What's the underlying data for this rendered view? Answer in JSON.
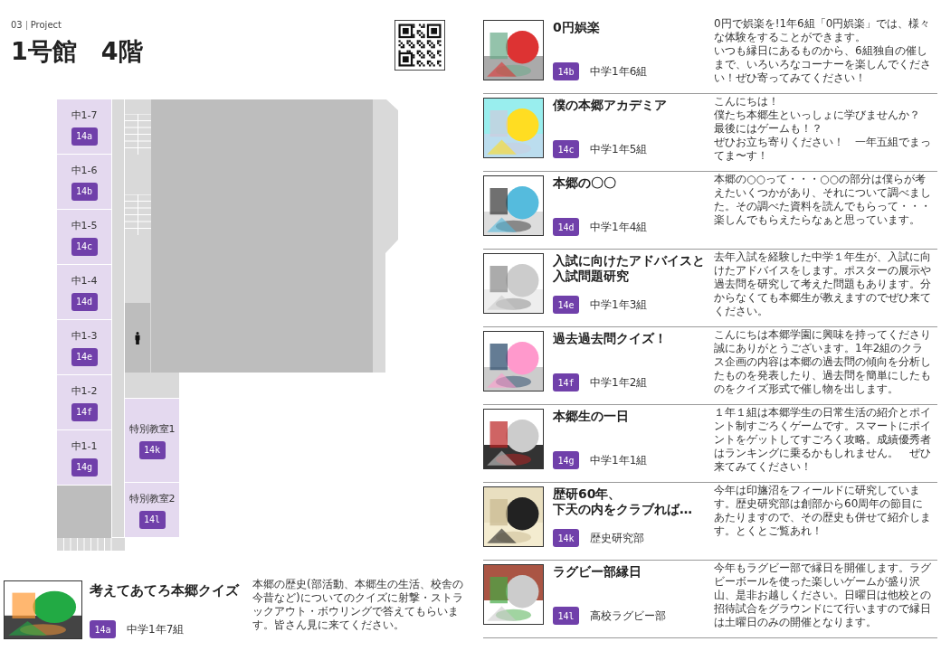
{
  "header": {
    "number": "03",
    "section": "Project",
    "title": "1号館　4階"
  },
  "floor_plan": {
    "rooms": [
      {
        "label": "中1-7",
        "code": "14a"
      },
      {
        "label": "中1-6",
        "code": "14b"
      },
      {
        "label": "中1-5",
        "code": "14c"
      },
      {
        "label": "中1-4",
        "code": "14d"
      },
      {
        "label": "中1-3",
        "code": "14e"
      },
      {
        "label": "中1-2",
        "code": "14f"
      },
      {
        "label": "中1-1",
        "code": "14g"
      }
    ],
    "special_rooms": [
      {
        "label": "特別教室1",
        "code": "14k"
      },
      {
        "label": "特別教室2",
        "code": "14l"
      }
    ]
  },
  "featured": {
    "title": "考えてあてろ本郷クイズ",
    "code": "14a",
    "group": "中学1年7組",
    "description": "本郷の歴史(部活動、本郷生の生活、校舎の今昔など)についてのクイズに射撃・ストラックアウト・ボウリングで答えてもらいます。皆さん見に来てください。"
  },
  "exhibits": [
    {
      "title": [
        "0円娯楽"
      ],
      "code": "14b",
      "group": "中学1年6組",
      "description": [
        "0円で娯楽を!1年6組「0円娯楽」では、様々な体験をすることができます。",
        "いつも縁日にあるものから、6組独自の催しまで、いろいろなコーナーを楽しんでください！ぜひ寄ってみてください！"
      ]
    },
    {
      "title": [
        "僕の本郷アカデミア"
      ],
      "code": "14c",
      "group": "中学1年5組",
      "description": [
        "こんにちは！",
        "僕たち本郷生といっしょに学びませんか？",
        "最後にはゲームも！？",
        "ぜひお立ち寄りください！　一年五組でまってま〜す！"
      ]
    },
    {
      "title": [
        "本郷の〇〇"
      ],
      "code": "14d",
      "group": "中学1年4組",
      "description": [
        "本郷の○○って・・・○○の部分は僕らが考えたいくつかがあり、それについて調べました。その調べた資料を読んでもらって・・・楽しんでもらえたらなぁと思っています。"
      ]
    },
    {
      "title": [
        "入試に向けたアドバイスと",
        "入試問題研究"
      ],
      "code": "14e",
      "group": "中学1年3組",
      "description": [
        "去年入試を経験した中学１年生が、入試に向けたアドバイスをします。ポスターの展示や過去問を研究して考えた問題もあります。分からなくても本郷生が教えますのでぜひ来てください。"
      ]
    },
    {
      "title": [
        "過去過去問クイズ！"
      ],
      "code": "14f",
      "group": "中学1年2組",
      "description": [
        "こんにちは本郷学園に興味を持ってくださり誠にありがとうございます。1年2組のクラス企画の内容は本郷の過去問の傾向を分析したものを発表したり、過去問を簡単にしたものをクイズ形式で催し物を出します。"
      ]
    },
    {
      "title": [
        "本郷生の一日"
      ],
      "code": "14g",
      "group": "中学1年1組",
      "description": [
        "１年１組は本郷学生の日常生活の紹介とポイント制すごろくゲームです。スマートにポイントをゲットしてすごろく攻略。成績優秀者はランキングに乗るかもしれません。　ぜひ来てみてください！"
      ]
    },
    {
      "title": [
        "歴研60年、",
        "下天の内をクラブれば…"
      ],
      "code": "14k",
      "group": "歴史研究部",
      "description": [
        "今年は印旛沼をフィールドに研究しています。歴史研究部は創部から60周年の節目にあたりますので、その歴史も併せて紹介します。とくとご覧あれ！"
      ]
    },
    {
      "title": [
        "ラグビー部縁日"
      ],
      "code": "14l",
      "group": "高校ラグビー部",
      "description": [
        "今年もラグビー部で縁日を開催します。ラグビーボールを使った楽しいゲームが盛り沢山、是非お越しください。日曜日は他校との招待試合をグラウンドにて行いますので縁日は土曜日のみの開催となります。"
      ]
    }
  ]
}
